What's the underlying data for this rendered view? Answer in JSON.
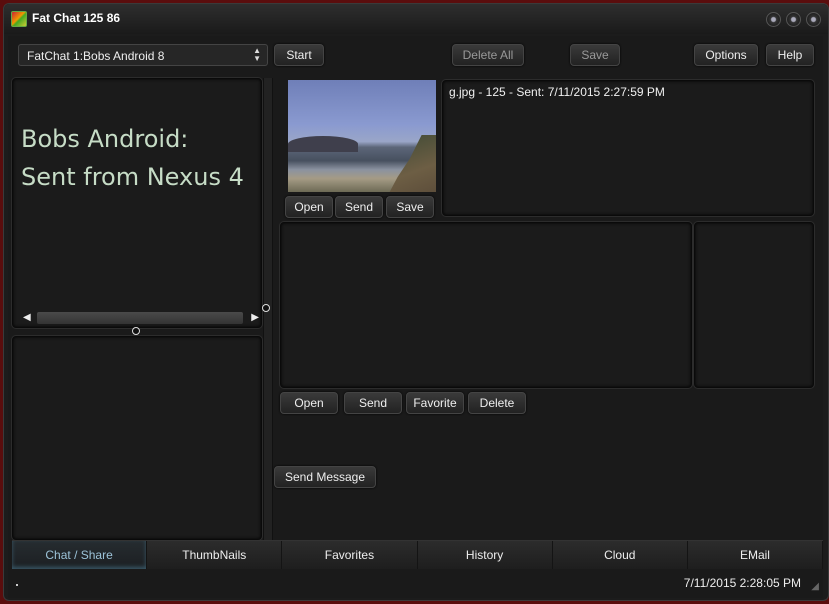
{
  "window": {
    "title": "Fat Chat 125 86",
    "icons": {
      "app": "app-logo-icon",
      "controls": [
        "minimize-icon",
        "maximize-icon",
        "close-icon"
      ]
    }
  },
  "toolbar": {
    "contact_select": {
      "value": "FatChat 1:Bobs Android 8",
      "icon": "updown-arrows-icon"
    },
    "start_label": "Start",
    "delete_all_label": "Delete All",
    "save_label": "Save",
    "options_label": "Options",
    "help_label": "Help"
  },
  "chat": {
    "lines": [
      "Bobs Android:",
      "Sent from Nexus 4"
    ],
    "text_color": "#c6dcc6"
  },
  "image_panel": {
    "image_alt": "beach photo thumbnail",
    "open_label": "Open",
    "send_label": "Send",
    "save_label": "Save",
    "info": "g.jpg - 125 - Sent: 7/11/2015 2:27:59 PM"
  },
  "file_panel": {
    "open_label": "Open",
    "send_label": "Send",
    "favorite_label": "Favorite",
    "delete_label": "Delete"
  },
  "send_message_label": "Send Message",
  "tabs": [
    {
      "label": "Chat / Share",
      "active": true
    },
    {
      "label": "ThumbNails"
    },
    {
      "label": "Favorites"
    },
    {
      "label": "History"
    },
    {
      "label": "Cloud"
    },
    {
      "label": "EMail"
    }
  ],
  "status": {
    "time": "7/11/2015 2:28:05 PM"
  },
  "colors": {
    "active_tab": "#9cc3d8",
    "background": "#1c1c1c"
  }
}
